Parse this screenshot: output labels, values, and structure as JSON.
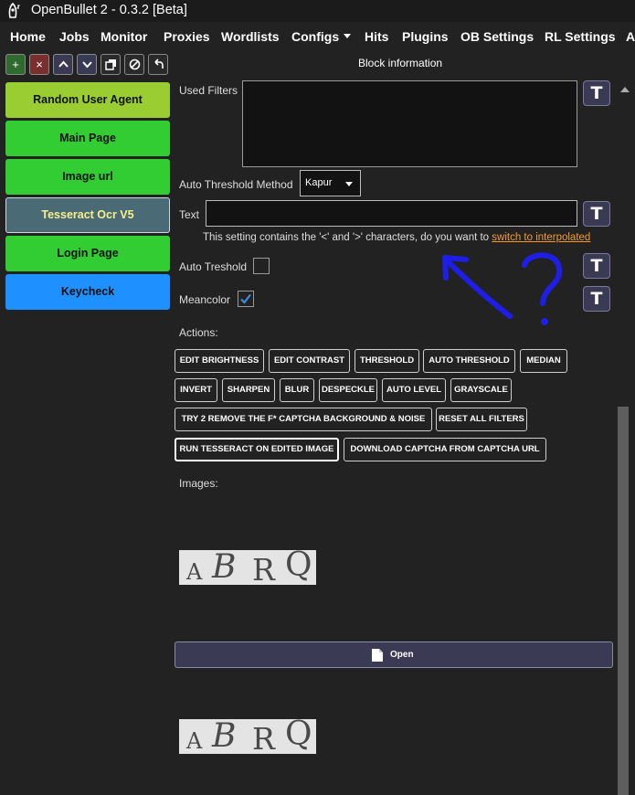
{
  "window": {
    "title": "OpenBullet 2 - 0.3.2 [Beta]"
  },
  "menu": {
    "items": [
      "Home",
      "Jobs",
      "Monitor",
      "Proxies",
      "Wordlists",
      "Configs",
      "Hits",
      "Plugins",
      "OB Settings",
      "RL Settings",
      "A"
    ]
  },
  "toolbar": {
    "add": "+",
    "remove": "×"
  },
  "panel": {
    "title": "Block information"
  },
  "blocks": [
    {
      "label": "Random User Agent",
      "color": "#9acd32"
    },
    {
      "label": "Main Page",
      "color": "#32cd32"
    },
    {
      "label": "Image url",
      "color": "#32cd32"
    },
    {
      "label": "Tesseract Ocr V5",
      "color": "#4a6a75",
      "text_color": "#f6f08a"
    },
    {
      "label": "Login Page",
      "color": "#32cd32"
    },
    {
      "label": "Keycheck",
      "color": "#1e90ff"
    }
  ],
  "form": {
    "used_filters_label": "Used Filters",
    "threshold_label": "Auto Threshold Method",
    "threshold_value": "Kapur",
    "text_label": "Text",
    "warning_text": "This setting contains the '<' and '>' characters, do you want to ",
    "warning_link": "switch to interpolated",
    "auto_treshold_label": "Auto Treshold",
    "auto_treshold_checked": false,
    "meancolor_label": "Meancolor",
    "meancolor_checked": true,
    "actions_label": "Actions:",
    "images_label": "Images:",
    "mode_button": "T"
  },
  "actions": [
    [
      "EDIT BRIGHTNESS",
      "EDIT CONTRAST",
      "THRESHOLD",
      "AUTO THRESHOLD",
      "MEDIAN"
    ],
    [
      "INVERT",
      "SHARPEN",
      "BLUR",
      "DESPECKLE",
      "AUTO LEVEL",
      "GRAYSCALE"
    ],
    [
      "TRY 2 REMOVE THE F* CAPTCHA BACKGROUND & NOISE",
      "RESET ALL FILTERS"
    ],
    [
      "RUN TESSERACT ON EDITED IMAGE",
      "DOWNLOAD CAPTCHA FROM CAPTCHA URL"
    ]
  ],
  "captcha": {
    "letters": [
      "A",
      "B",
      "R",
      "Q"
    ]
  },
  "open_button": "Open",
  "annotation": {
    "color": "#1e1ee6",
    "mark": "?"
  }
}
